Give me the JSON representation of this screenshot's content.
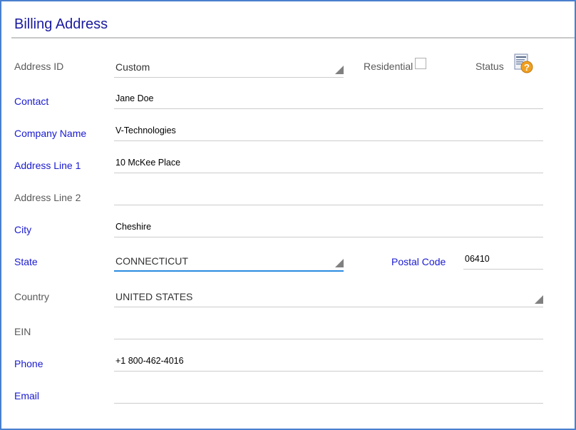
{
  "header": {
    "title": "Billing Address"
  },
  "address_id": {
    "label": "Address ID",
    "value": "Custom"
  },
  "residential": {
    "label": "Residential",
    "checked": false
  },
  "status": {
    "label": "Status",
    "icon": "status-help-icon"
  },
  "contact": {
    "label": "Contact",
    "value": "Jane Doe"
  },
  "company_name": {
    "label": "Company Name",
    "value": "V-Technologies"
  },
  "address_line1": {
    "label": "Address Line 1",
    "value": "10 McKee Place"
  },
  "address_line2": {
    "label": "Address Line 2",
    "value": ""
  },
  "city": {
    "label": "City",
    "value": "Cheshire"
  },
  "state": {
    "label": "State",
    "value": "CONNECTICUT"
  },
  "postal_code": {
    "label": "Postal Code",
    "value": "06410"
  },
  "country": {
    "label": "Country",
    "value": "UNITED STATES"
  },
  "ein": {
    "label": "EIN",
    "value": ""
  },
  "phone": {
    "label": "Phone",
    "value": "+1 800-462-4016"
  },
  "email": {
    "label": "Email",
    "value": ""
  },
  "colors": {
    "required_label": "#1a1ad0",
    "optional_label": "#5a5a5a",
    "title": "#1a1aa0",
    "focus_underline": "#2a8be0",
    "frame_border": "#4a7fcf"
  }
}
